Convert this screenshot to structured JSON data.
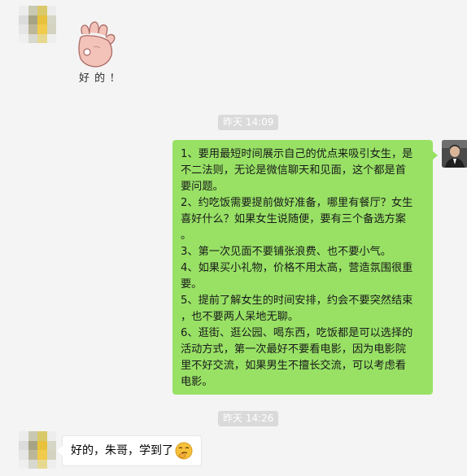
{
  "chat": {
    "sticker_caption": "好 的 !",
    "time_1": "昨天 14:09",
    "outgoing_lines": [
      "1、要用最短时间展示自己的优点来吸引女生，是",
      "不二法则，无论是微信聊天和见面，这个都是首",
      "要问题。",
      "2、约吃饭需要提前做好准备，哪里有餐厅？女生",
      "喜好什么？如果女生说随便，要有三个备选方案",
      "。",
      "3、第一次见面不要铺张浪费、也不要小气。",
      "4、如果买小礼物，价格不用太高，营造氛围很重",
      "要。",
      "5、提前了解女生的时间安排，约会不要突然结束",
      "，也不要两人呆地无聊。",
      "6、逛街、逛公园、喝东西，吃饭都是可以选择的",
      "活动方式，第一次最好不要看电影，因为电影院",
      "里不好交流，如果男生不擅长交流，可以考虑看",
      "电影。"
    ],
    "time_2": "昨天 14:26",
    "incoming_text": "好的，朱哥，学到了",
    "emoji_icon": "thinking-smirk-emoji-icon"
  }
}
